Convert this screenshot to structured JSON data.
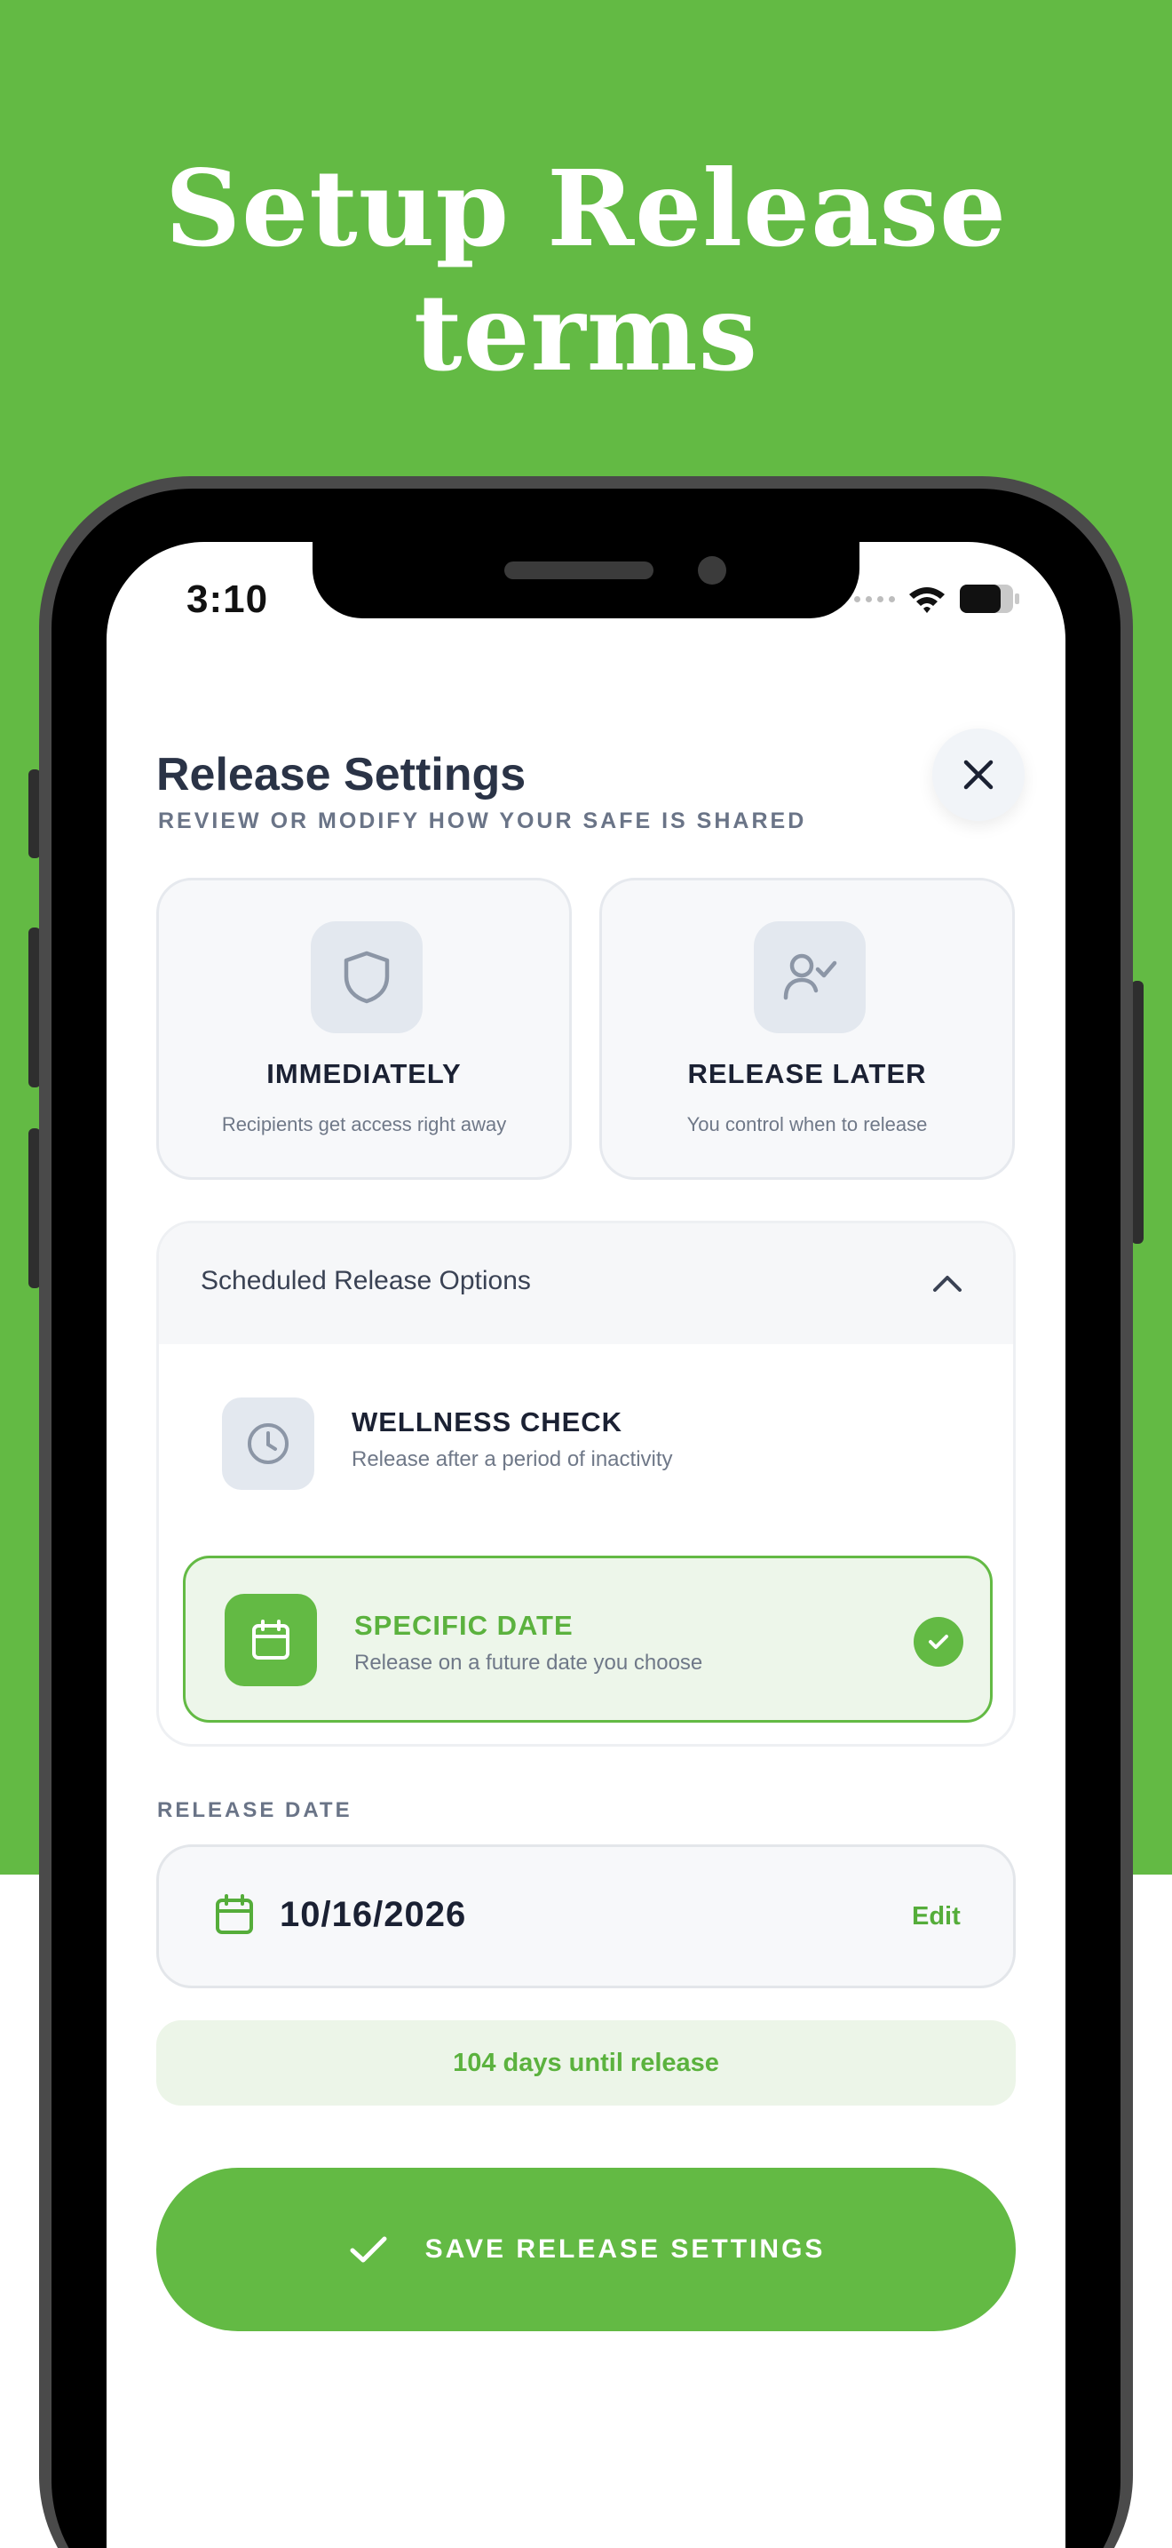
{
  "promo": {
    "headline_line1": "Setup Release",
    "headline_line2": "terms"
  },
  "status_bar": {
    "time": "3:10",
    "icons": [
      "signal-dots-icon",
      "wifi-icon",
      "battery-icon"
    ]
  },
  "header": {
    "title": "Release Settings",
    "subtitle": "REVIEW OR MODIFY HOW YOUR SAFE IS SHARED",
    "close_icon": "close-icon"
  },
  "release_modes": [
    {
      "title": "IMMEDIATELY",
      "description": "Recipients get access right away",
      "icon": "shield-icon"
    },
    {
      "title": "RELEASE LATER",
      "description": "You control when to release",
      "icon": "user-check-icon"
    }
  ],
  "scheduled": {
    "title": "Scheduled Release Options",
    "expanded": true,
    "options": [
      {
        "title": "WELLNESS CHECK",
        "description": "Release after a period of inactivity",
        "icon": "clock-icon",
        "selected": false
      },
      {
        "title": "SPECIFIC DATE",
        "description": "Release on a future date you choose",
        "icon": "calendar-icon",
        "selected": true
      }
    ]
  },
  "release_date": {
    "label": "RELEASE DATE",
    "value": "10/16/2026",
    "edit_label": "Edit"
  },
  "countdown": "104 days until release",
  "save_button": "SAVE RELEASE SETTINGS",
  "colors": {
    "brand_green": "#63ba44",
    "text_dark": "#2a3346",
    "text_muted": "#6a7487",
    "selected_bg": "#edf6ea"
  }
}
